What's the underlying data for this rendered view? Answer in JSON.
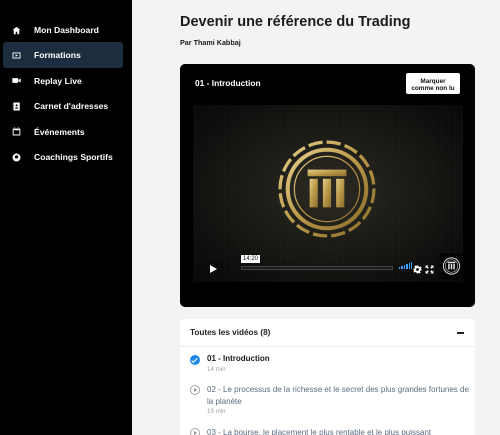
{
  "sidebar": {
    "items": [
      {
        "label": "Mon Dashboard",
        "icon": "home-icon",
        "active": false
      },
      {
        "label": "Formations",
        "icon": "video-icon",
        "active": true
      },
      {
        "label": "Replay Live",
        "icon": "camera-icon",
        "active": false
      },
      {
        "label": "Carnet d'adresses",
        "icon": "address-book-icon",
        "active": false
      },
      {
        "label": "Événements",
        "icon": "calendar-icon",
        "active": false
      },
      {
        "label": "Coachings Sportifs",
        "icon": "sport-ball-icon",
        "active": false
      }
    ]
  },
  "course": {
    "title": "Devenir une référence du Trading",
    "author": "Par Thami Kabbaj"
  },
  "video": {
    "title": "01 - Introduction",
    "mark_unread_line1": "Marquer",
    "mark_unread_line2": "comme non lu",
    "current_time": "14:20",
    "progress_fraction": 0.0,
    "volume_color": "#3aa0ff"
  },
  "playlist": {
    "header": "Toutes les vidéos (8)",
    "items": [
      {
        "title": "01 - Introduction",
        "duration": "14 min",
        "completed": true
      },
      {
        "title": "02 - Le processus de la richesse et le secret des plus grandes fortunes de la planète",
        "duration": "19 min",
        "completed": false
      },
      {
        "title": "03 - La bourse, le placement le plus rentable et le plus puissant",
        "duration": "",
        "completed": false
      }
    ]
  },
  "colors": {
    "sidebar_bg": "#000000",
    "active_item_bg": "#1c2d40",
    "accent_blue": "#1e88e5",
    "page_bg": "#f2f3f4"
  }
}
